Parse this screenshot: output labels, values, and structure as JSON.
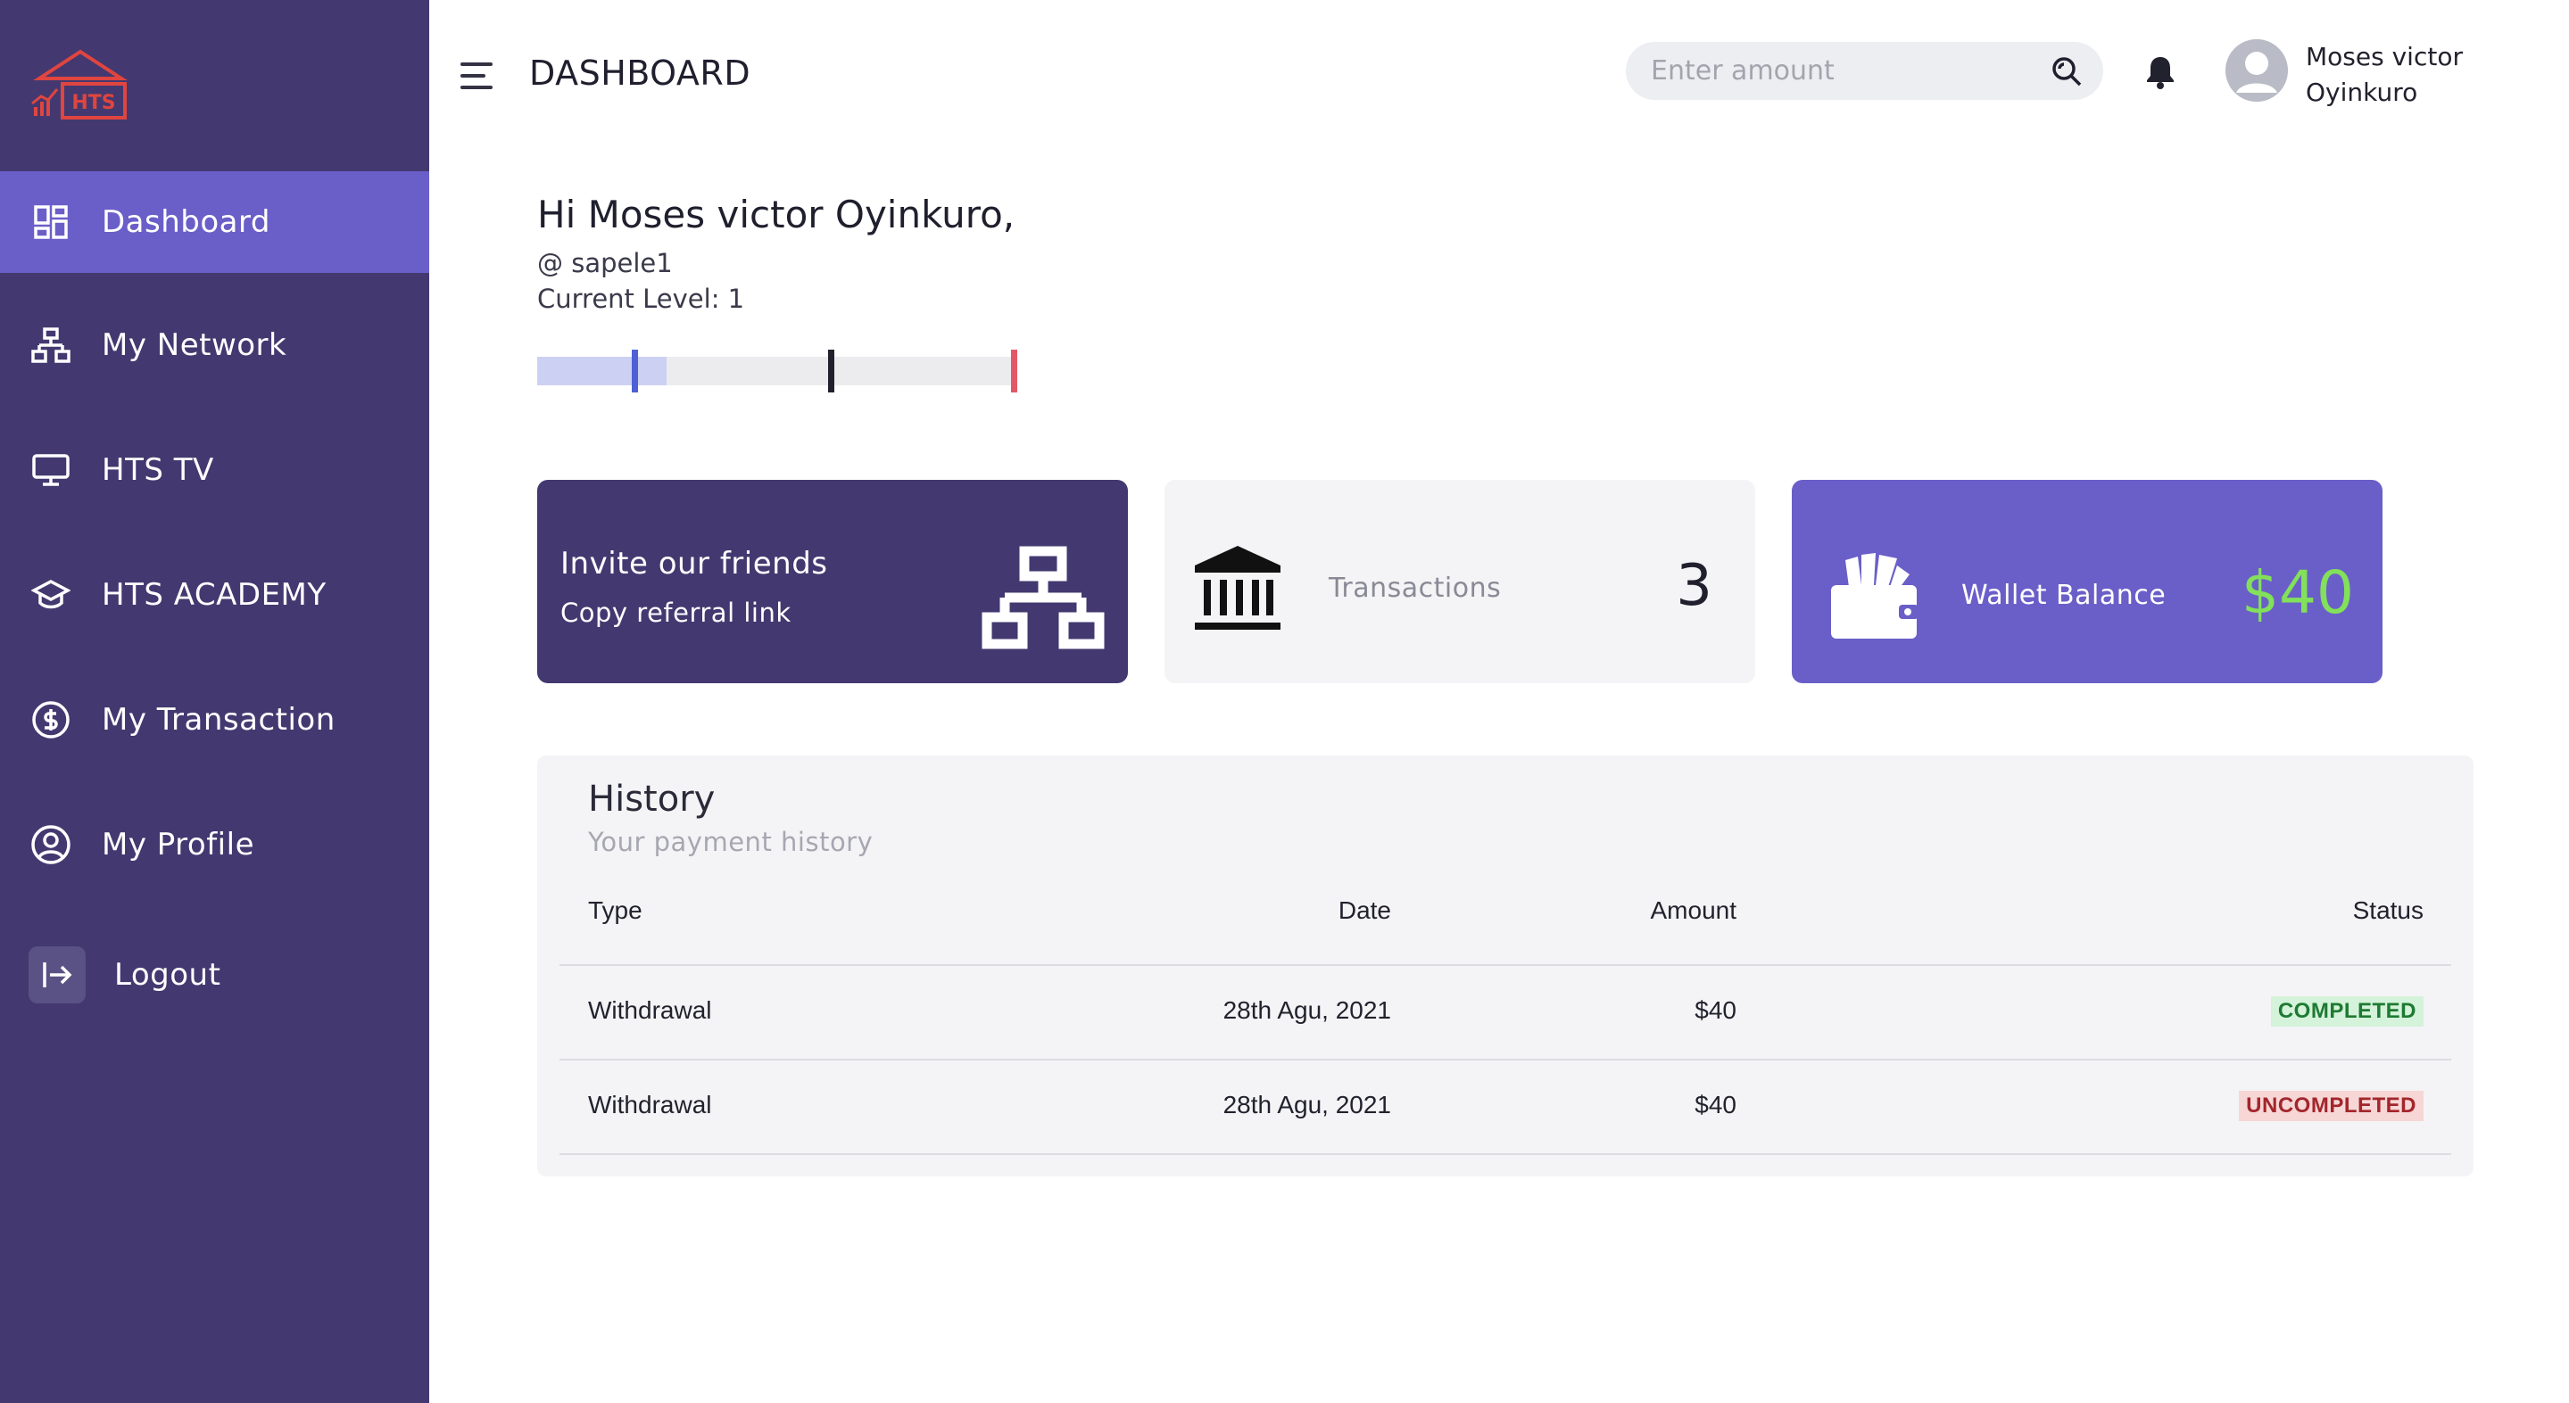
{
  "app": {
    "logo_text": "HTS"
  },
  "sidebar": {
    "items": [
      {
        "label": "Dashboard",
        "icon": "dashboard-grid-icon",
        "active": true
      },
      {
        "label": "My Network",
        "icon": "network-icon",
        "active": false
      },
      {
        "label": "HTS TV",
        "icon": "monitor-icon",
        "active": false
      },
      {
        "label": "HTS ACADEMY",
        "icon": "graduation-cap-icon",
        "active": false
      },
      {
        "label": "My Transaction",
        "icon": "dollar-circle-icon",
        "active": false
      },
      {
        "label": "My Profile",
        "icon": "user-circle-icon",
        "active": false
      },
      {
        "label": "Logout",
        "icon": "logout-icon",
        "active": false
      }
    ]
  },
  "header": {
    "title": "DASHBOARD",
    "search_placeholder": "Enter amount",
    "user_name_line1": "Moses victor",
    "user_name_line2": "Oyinkuro"
  },
  "greeting": {
    "text": "Hi Moses victor Oyinkuro,",
    "handle": "@ sapele1",
    "level": "Current Level: 1"
  },
  "level_progress": {
    "fill_fraction": 0.27
  },
  "cards": {
    "invite": {
      "title": "Invite our friends",
      "subtitle": "Copy referral link"
    },
    "transactions": {
      "label": "Transactions",
      "value": "3"
    },
    "wallet": {
      "label": "Wallet Balance",
      "value": "$40"
    }
  },
  "history": {
    "title": "History",
    "subtitle": "Your payment history",
    "columns": {
      "type": "Type",
      "date": "Date",
      "amount": "Amount",
      "status": "Status"
    },
    "rows": [
      {
        "type": "Withdrawal",
        "date": "28th Agu, 2021",
        "amount": "$40",
        "status": "COMPLETED"
      },
      {
        "type": "Withdrawal",
        "date": "28th Agu, 2021",
        "amount": "$40",
        "status": "UNCOMPLETED"
      }
    ]
  },
  "colors": {
    "sidebar_bg": "#433970",
    "accent": "#6a5fc8",
    "wallet_value": "#82e05a",
    "status_completed": "#1e7a32",
    "status_uncompleted": "#a2262c"
  }
}
